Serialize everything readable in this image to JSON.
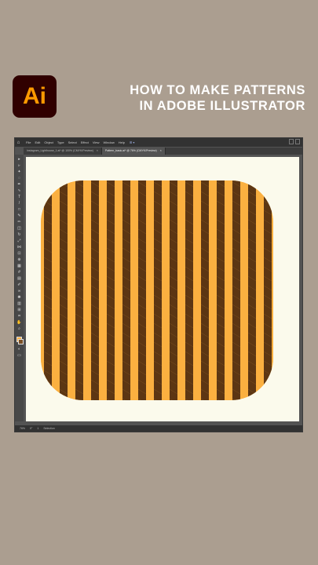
{
  "brand": {
    "logo_text": "Ai",
    "logo_bg": "#300000",
    "logo_fg": "#ff9a00"
  },
  "headline": {
    "line1": "HOW TO MAKE PATTERNS",
    "line2": "IN ADOBE ILLUSTRATOR"
  },
  "app": {
    "menu": [
      "File",
      "Edit",
      "Object",
      "Type",
      "Select",
      "Effect",
      "View",
      "Window",
      "Help"
    ],
    "workspace_label": "⊞ ▾",
    "tabs": [
      {
        "label": "Instagram_Lighthouse_1.ai* @ 100% (CMYK/Preview)",
        "active": false
      },
      {
        "label": "Pattern_basic.ai* @ 76% (CMYK/Preview)",
        "active": true
      }
    ],
    "status": {
      "zoom": "76%",
      "angle": "0°",
      "page": "1",
      "mode": "Selection"
    }
  },
  "pattern": {
    "colors": {
      "light": "#fbb040",
      "dark": "#5c3613",
      "artboard": "#fbfaec",
      "page_bg": "#ab9e90"
    }
  }
}
